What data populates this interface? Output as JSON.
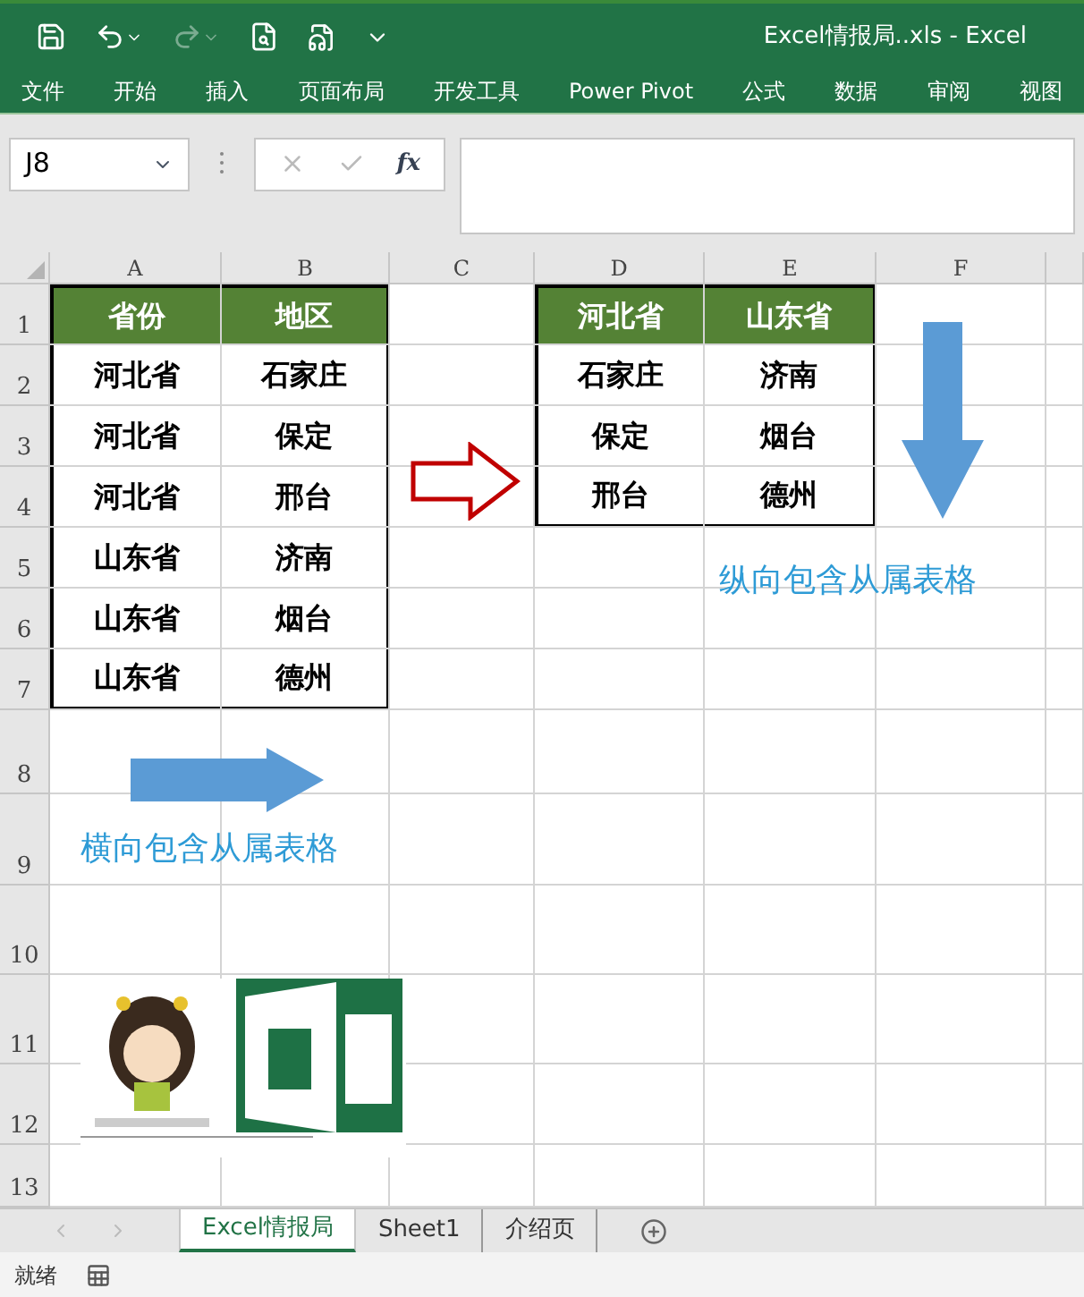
{
  "window": {
    "title": "Excel情报局..xls  -  Excel"
  },
  "ribbon_tabs": [
    "文件",
    "开始",
    "插入",
    "页面布局",
    "开发工具",
    "Power Pivot",
    "公式",
    "数据",
    "审阅",
    "视图"
  ],
  "formula_bar": {
    "name_box": "J8",
    "function_label": "fx"
  },
  "column_letters": [
    "A",
    "B",
    "C",
    "D",
    "E",
    "F"
  ],
  "row_numbers": [
    "1",
    "2",
    "3",
    "4",
    "5",
    "6",
    "7",
    "8",
    "9",
    "10",
    "11",
    "12",
    "13"
  ],
  "table_left": {
    "columns": [
      "省份",
      "地区"
    ],
    "rows": [
      [
        "河北省",
        "石家庄"
      ],
      [
        "河北省",
        "保定"
      ],
      [
        "河北省",
        "邢台"
      ],
      [
        "山东省",
        "济南"
      ],
      [
        "山东省",
        "烟台"
      ],
      [
        "山东省",
        "德州"
      ]
    ]
  },
  "table_right": {
    "columns": [
      "河北省",
      "山东省"
    ],
    "rows": [
      [
        "石家庄",
        "济南"
      ],
      [
        "保定",
        "烟台"
      ],
      [
        "邢台",
        "德州"
      ]
    ]
  },
  "text_boxes": [
    {
      "text": "纵向包含从属表格"
    },
    {
      "text": "横向包含从属表格"
    }
  ],
  "sheet_tabs": [
    {
      "label": "Excel情报局",
      "selected": true
    },
    {
      "label": "Sheet1",
      "selected": false
    },
    {
      "label": "介绍页",
      "selected": false
    }
  ],
  "status_bar": {
    "text": "就绪"
  }
}
